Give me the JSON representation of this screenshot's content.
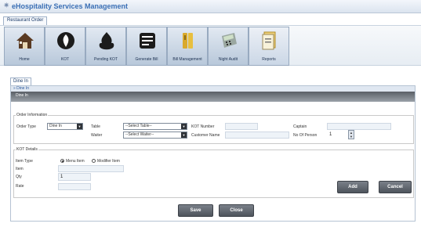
{
  "app": {
    "title": "eHospitality Services Management"
  },
  "menu_tab": "Restaurant Order",
  "toolbar": [
    {
      "label": "Home",
      "icon": "home-icon"
    },
    {
      "label": "KOT",
      "icon": "kot-icon"
    },
    {
      "label": "Pending KOT",
      "icon": "pending-kot-icon"
    },
    {
      "label": "Generate Bill",
      "icon": "generate-bill-icon"
    },
    {
      "label": "Bill Management",
      "icon": "bill-management-icon"
    },
    {
      "label": "Night Audit",
      "icon": "night-audit-icon"
    },
    {
      "label": "Reports",
      "icon": "reports-icon"
    }
  ],
  "page_tab": "Dine In",
  "breadcrumb": "Dine In",
  "section_header": "Dine In",
  "order_info": {
    "legend": "Order Information",
    "order_type_label": "Order Type",
    "order_type_value": "Dine In",
    "table_label": "Table",
    "table_value": "--Select Table--",
    "waiter_label": "Waiter",
    "waiter_value": "--Select Waiter--",
    "kot_number_label": "KOT Number",
    "customer_name_label": "Customer Name",
    "captain_label": "Captain",
    "no_of_person_label": "No Of Person",
    "no_of_person_value": "1"
  },
  "kot_details": {
    "legend": "KOT Details",
    "item_type_label": "Item Type",
    "radio_menu_item": "Menu Item",
    "radio_modifier_item": "Modifier Item",
    "item_label": "Item",
    "qty_label": "Qty",
    "qty_value": "1",
    "rate_label": "Rate",
    "add_label": "Add",
    "cancel_label": "Cancel"
  },
  "footer": {
    "save_label": "Save",
    "close_label": "Close"
  },
  "colors": {
    "title_blue": "#3a6fb5",
    "header_gray": "#5a5f66",
    "button_dark": "#4e545c"
  }
}
